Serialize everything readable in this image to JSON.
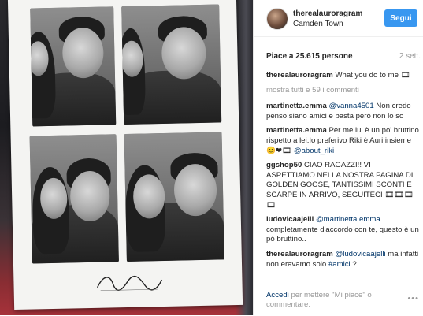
{
  "post": {
    "username": "therealauroragram",
    "location": "Camden Town",
    "follow_label": "Segui",
    "likes": "Piace a 25.615 persone",
    "date": "2 sett.",
    "caption_user": "therealauroragram",
    "caption_text": "What you do to me ",
    "caption_emoji": "🎞",
    "load_more": "mostra tutti e 59 i commenti",
    "photo_logo_text": "Boogaloosh"
  },
  "comments": [
    {
      "user": "martinetta.emma",
      "mention": "@vanna4501",
      "text": " Non credo penso siano amici e basta però non lo so"
    },
    {
      "user": "martinetta.emma",
      "text": " Per me lui è un po' bruttino rispetto a lei.Io preferivo Riki è Auri insieme😊❤🎞 ",
      "mention": "@about_riki"
    },
    {
      "user": "ggshop50",
      "text": " CIAO RAGAZZI!! VI ASPETTIAMO NELLA NOSTRA PAGINA DI GOLDEN GOOSE, TANTISSIMI SCONTI E SCARPE IN ARRIVO, SEGUITECI 🎞🎞🎞🎞"
    },
    {
      "user": "ludovicaajelli",
      "mention": "@martinetta.emma",
      "text": " completamente d'accordo con te, questo è un pó bruttino.."
    },
    {
      "user": "therealauroragram",
      "mention": "@ludovicaajelli",
      "text": " ma infatti non eravamo solo ",
      "tag": "#amici",
      "text2": " ?"
    }
  ],
  "footer": {
    "login_link": "Accedi",
    "prompt": " per mettere \"Mi piace\" o commentare.",
    "more": "•••"
  },
  "colors": {
    "accent": "#3897f0",
    "link": "#003569",
    "muted": "#999999"
  }
}
